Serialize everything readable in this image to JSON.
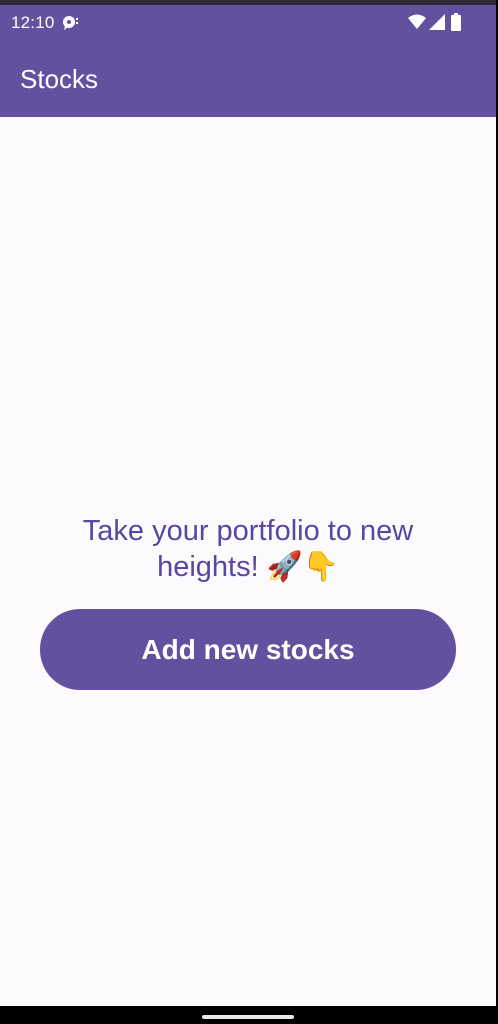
{
  "status_bar": {
    "time": "12:10",
    "icons": [
      "chat-notification-icon",
      "wifi-icon",
      "signal-icon",
      "battery-icon"
    ]
  },
  "app_bar": {
    "title": "Stocks"
  },
  "main": {
    "tagline": "Take your portfolio to new heights! 🚀👇",
    "add_button_label": "Add new stocks"
  },
  "colors": {
    "primary": "#6351A0",
    "background": "#FDFAFE",
    "tagline_text": "#5847A0",
    "on_primary": "#FFFFFF"
  }
}
